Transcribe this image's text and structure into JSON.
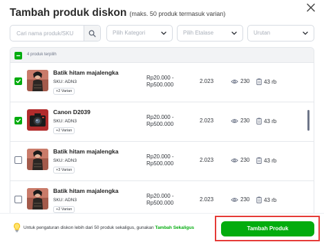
{
  "modal": {
    "title": "Tambah produk diskon",
    "subtitle": "(maks. 50 produk termasuk varian)",
    "close_icon": "close-icon"
  },
  "filters": {
    "search_placeholder": "Cari nama produk/SKU",
    "category_placeholder": "Pilih Kategori",
    "etalase_placeholder": "Pilih Etalase",
    "sort_placeholder": "Urutan"
  },
  "table": {
    "selected_label": "4 produk terpilih",
    "rows": [
      {
        "name": "Batik hitam majalengka",
        "sku": "SKU: ADN3",
        "varian": "+2 Varian",
        "price_1": "Rp20.000 -",
        "price_2": "Rp500.000",
        "stock": "2.023",
        "views": "230",
        "sold": "43 rb",
        "checked": true,
        "image": "woman-batik"
      },
      {
        "name": "Canon D2039",
        "sku": "SKU: ADN3",
        "varian": "+2 Varian",
        "price_1": "Rp20.000 -",
        "price_2": "Rp500.000",
        "stock": "2.023",
        "views": "230",
        "sold": "43 rb",
        "checked": true,
        "image": "camera"
      },
      {
        "name": "Batik hitam majalengka",
        "sku": "SKU: ADN3",
        "varian": "+3 Varian",
        "price_1": "Rp20.000 -",
        "price_2": "Rp500.000",
        "stock": "2.023",
        "views": "230",
        "sold": "43 rb",
        "checked": false,
        "image": "woman-batik"
      },
      {
        "name": "Batik hitam majalengka",
        "sku": "SKU: ADN3",
        "varian": "+2 Varian",
        "price_1": "Rp20.000 -",
        "price_2": "Rp500.000",
        "stock": "2.023",
        "views": "230",
        "sold": "43 rb",
        "checked": false,
        "image": "woman-batik"
      }
    ]
  },
  "footer": {
    "note": "Untuk pengaturan diskon lebih dari 50 produk sekaligus, gunakan",
    "note_link": "Tambah Sekaligus",
    "primary_button": "Tambah Produk"
  },
  "colors": {
    "accent": "#03ac0e",
    "highlight_border": "#e53935"
  }
}
